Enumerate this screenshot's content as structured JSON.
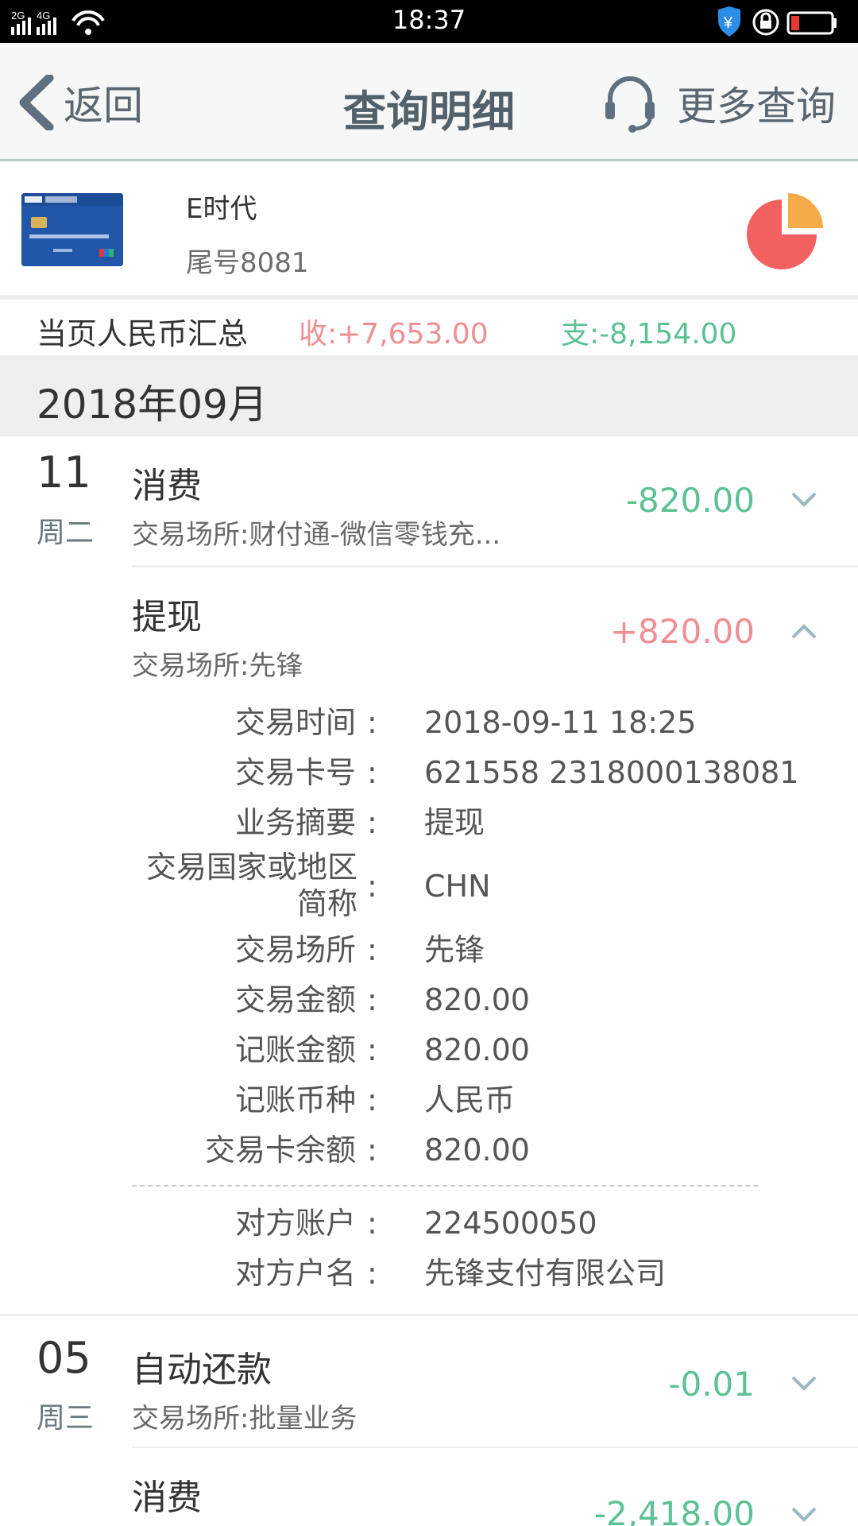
{
  "status_bar": {
    "signal_1": "2G",
    "signal_2": "4G",
    "time": "18:37"
  },
  "nav": {
    "back_label": "返回",
    "title": "查询明细",
    "more_label": "更多查询"
  },
  "card": {
    "name": "E时代",
    "tail": "尾号8081"
  },
  "summary": {
    "label": "当页人民币汇总",
    "income": "收:+7,653.00",
    "expense": "支:-8,154.00"
  },
  "month": "2018年09月",
  "transactions": [
    {
      "day": "11",
      "weekday": "周二",
      "type": "消费",
      "place": "交易场所:财付通-微信零钱充...",
      "amount": "-820.00"
    },
    {
      "type": "提现",
      "place": "交易场所:先锋",
      "amount": "+820.00",
      "details": [
        {
          "label": "交易时间",
          "value": "2018-09-11 18:25"
        },
        {
          "label": "交易卡号",
          "value": "621558 2318000138081"
        },
        {
          "label": "业务摘要",
          "value": "提现"
        },
        {
          "label": "交易国家或地区简称",
          "value": "CHN"
        },
        {
          "label": "交易场所",
          "value": "先锋"
        },
        {
          "label": "交易金额",
          "value": "820.00"
        },
        {
          "label": "记账金额",
          "value": "820.00"
        },
        {
          "label": "记账币种",
          "value": "人民币"
        },
        {
          "label": "交易卡余额",
          "value": "820.00"
        }
      ],
      "counterparty": [
        {
          "label": "对方账户",
          "value": "224500050"
        },
        {
          "label": "对方户名",
          "value": "先锋支付有限公司"
        }
      ]
    },
    {
      "day": "05",
      "weekday": "周三",
      "type": "自动还款",
      "place": "交易场所:批量业务",
      "amount": "-0.01"
    },
    {
      "type": "消费",
      "amount": "-2,418.00"
    }
  ],
  "colors": {
    "income": "#ef8f94",
    "expense": "#5cc193",
    "nav_title": "#52606a",
    "pie_red": "#f26060",
    "pie_orange": "#f6aa48"
  },
  "icons": [
    "back-chevron-icon",
    "headset-icon",
    "pie-chart-icon",
    "chevron-down-icon",
    "chevron-up-icon"
  ]
}
